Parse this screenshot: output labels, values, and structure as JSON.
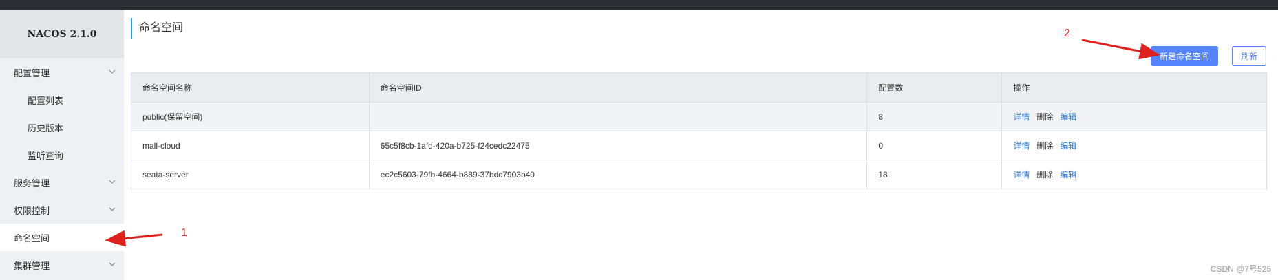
{
  "brand": {
    "title": "NACOS 2.1.0"
  },
  "sidebar": {
    "items": [
      {
        "label": "配置管理",
        "sub": false,
        "has_chevron": true
      },
      {
        "label": "配置列表",
        "sub": true,
        "has_chevron": false
      },
      {
        "label": "历史版本",
        "sub": true,
        "has_chevron": false
      },
      {
        "label": "监听查询",
        "sub": true,
        "has_chevron": false
      },
      {
        "label": "服务管理",
        "sub": false,
        "has_chevron": true
      },
      {
        "label": "权限控制",
        "sub": false,
        "has_chevron": true
      },
      {
        "label": "命名空间",
        "sub": false,
        "has_chevron": false,
        "active": true
      },
      {
        "label": "集群管理",
        "sub": false,
        "has_chevron": true
      }
    ]
  },
  "main": {
    "title": "命名空间",
    "new_button": "新建命名空间",
    "refresh_button": "刷新",
    "table": {
      "columns": [
        "命名空间名称",
        "命名空间ID",
        "配置数",
        "操作"
      ],
      "rows": [
        {
          "name": "public(保留空间)",
          "id": "",
          "count": "8"
        },
        {
          "name": "mall-cloud",
          "id": "65c5f8cb-1afd-420a-b725-f24cedc22475",
          "count": "0"
        },
        {
          "name": "seata-server",
          "id": "ec2c5603-79fb-4664-b889-37bdc7903b40",
          "count": "18"
        }
      ],
      "actions": {
        "detail": "详情",
        "delete": "删除",
        "edit": "编辑"
      }
    }
  },
  "annotations": {
    "one": "1",
    "two": "2",
    "color": "#e0201d"
  },
  "watermark": "CSDN @7号525",
  "colors": {
    "primary": "#5584ff",
    "link": "#2f7de1",
    "topbar": "#2b2e33",
    "sidebar": "#eef0f3"
  }
}
